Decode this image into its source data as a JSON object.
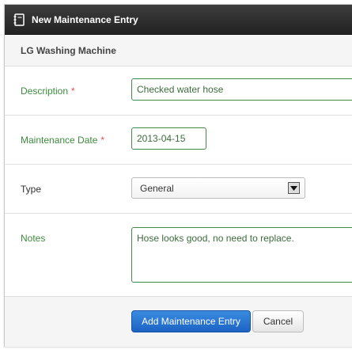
{
  "dialog": {
    "title": "New Maintenance Entry",
    "subtitle": "LG Washing Machine"
  },
  "form": {
    "description": {
      "label": "Description",
      "required_mark": "*",
      "value": "Checked water hose"
    },
    "date": {
      "label": "Maintenance Date",
      "required_mark": "*",
      "value": "2013-04-15"
    },
    "type": {
      "label": "Type",
      "selected": "General"
    },
    "notes": {
      "label": "Notes",
      "value": "Hose looks good, no need to replace."
    }
  },
  "actions": {
    "submit_label": "Add Maintenance Entry",
    "cancel_label": "Cancel"
  },
  "colors": {
    "title_bar": "#2b2b2b",
    "valid_green": "#468847",
    "required_red": "#d9534f",
    "primary_blue": "#2a78d6"
  },
  "icons": {
    "title": "notebook-icon",
    "select_arrow": "triangle-down-icon"
  }
}
